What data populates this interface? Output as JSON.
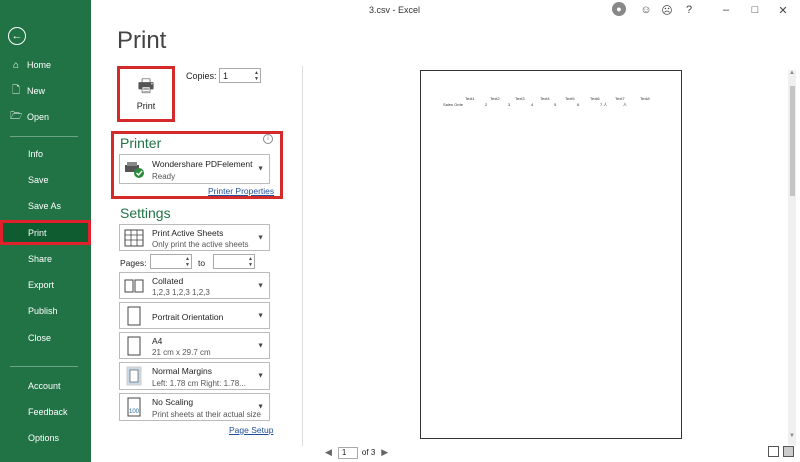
{
  "window": {
    "title": "3.csv  -  Excel",
    "avatar_icon": "user-avatar-icon",
    "smile_icon": "smile-icon",
    "frown_icon": "frown-icon",
    "help_icon": "help-icon",
    "minimize_icon": "minimize-icon",
    "restore_icon": "restore-icon",
    "close_icon": "close-icon"
  },
  "sidebar": {
    "back_icon": "back-arrow-icon",
    "items": [
      {
        "label": "Home",
        "icon": "home-icon"
      },
      {
        "label": "New",
        "icon": "new-document-icon"
      },
      {
        "label": "Open",
        "icon": "open-folder-icon"
      },
      {
        "label": "Info"
      },
      {
        "label": "Save"
      },
      {
        "label": "Save As"
      },
      {
        "label": "Print",
        "selected": true
      },
      {
        "label": "Share"
      },
      {
        "label": "Export"
      },
      {
        "label": "Publish"
      },
      {
        "label": "Close"
      },
      {
        "label": "Account"
      },
      {
        "label": "Feedback"
      },
      {
        "label": "Options"
      }
    ],
    "accent": "#217346",
    "selected_bg": "#0e5c30",
    "highlight_border": "#d42a2a"
  },
  "print": {
    "title": "Print",
    "print_button": "Print",
    "copies_label": "Copies:",
    "copies_value": "1",
    "printer_heading": "Printer",
    "printer_name": "Wondershare PDFelement",
    "printer_status": "Ready",
    "printer_properties": "Printer Properties",
    "settings_heading": "Settings",
    "settings": [
      {
        "main": "Print Active Sheets",
        "sub": "Only print the active sheets"
      },
      {
        "main": "Collated",
        "sub": "1,2,3    1,2,3    1,2,3"
      },
      {
        "main": "Portrait Orientation",
        "sub": ""
      },
      {
        "main": "A4",
        "sub": "21 cm x 29.7 cm"
      },
      {
        "main": "Normal Margins",
        "sub": "Left:  1.78 cm    Right:  1.78..."
      },
      {
        "main": "No Scaling",
        "sub": "Print sheets at their actual size"
      }
    ],
    "pages_label": "Pages:",
    "to_label": "to",
    "page_setup": "Page Setup"
  },
  "preview": {
    "header_row": [
      "Text1",
      "Text2",
      "Text3",
      "Text4",
      "Text5",
      "Text6",
      "Text7",
      "Text8"
    ],
    "data_row_label": "Sales Orde",
    "data_row": [
      "2",
      "3",
      "4",
      "5",
      "6",
      "7 人",
      "人"
    ],
    "current_page": "1",
    "of_pages": "of 3"
  }
}
